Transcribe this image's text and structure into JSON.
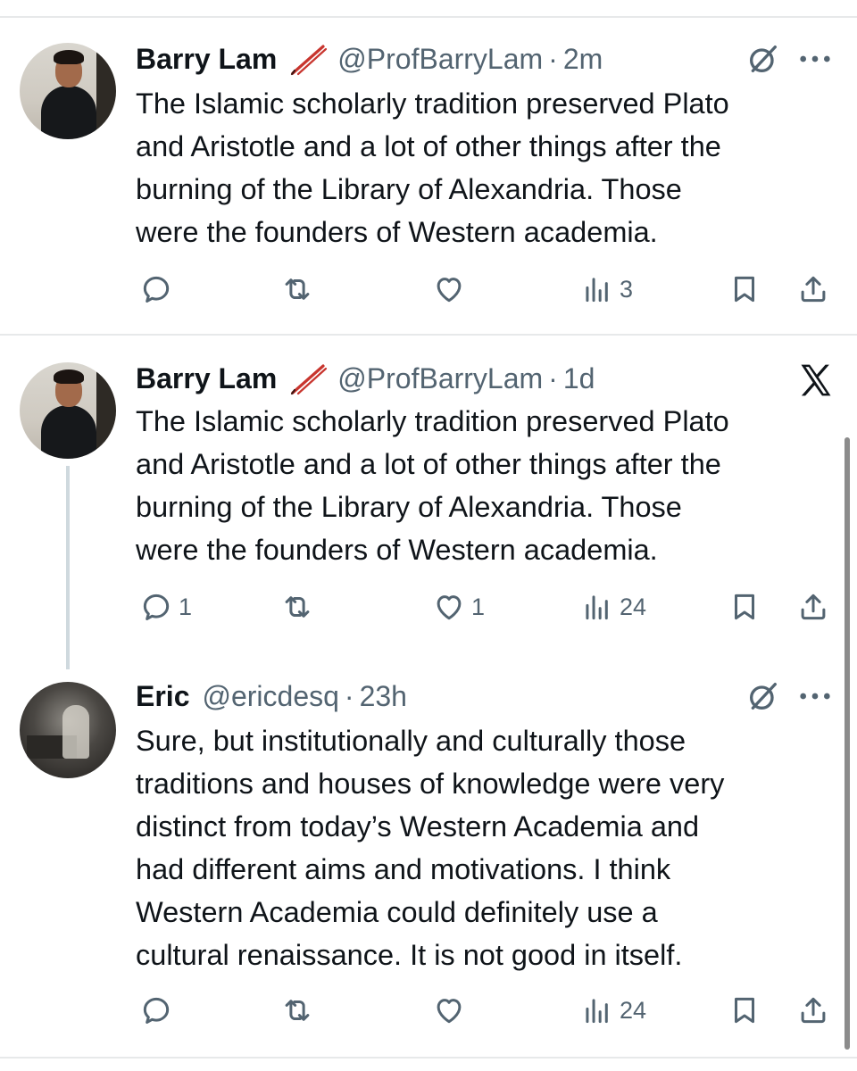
{
  "tweets": [
    {
      "name": "Barry Lam",
      "handle": "@ProfBarryLam",
      "separator": "·",
      "time": "2m",
      "lines": [
        "The Islamic scholarly tradition preserved Plato",
        "and Aristotle and a lot of other things after the",
        "burning of the Library of Alexandria. Those",
        "were the founders of Western academia."
      ],
      "replies": "",
      "retweets": "",
      "likes": "",
      "views": "3"
    },
    {
      "name": "Barry Lam",
      "handle": "@ProfBarryLam",
      "separator": "·",
      "time": "1d",
      "lines": [
        "The Islamic scholarly tradition preserved Plato",
        "and Aristotle and a lot of other things after the",
        "burning of the Library of Alexandria. Those",
        "were the founders of Western academia."
      ],
      "replies": "1",
      "retweets": "",
      "likes": "1",
      "views": "24"
    },
    {
      "name": "Eric",
      "handle": "@ericdesq",
      "separator": "·",
      "time": "23h",
      "lines": [
        "Sure, but institutionally and culturally those",
        "traditions and houses of knowledge were very",
        "distinct from today’s Western Academia and",
        "had different aims and motivations. I think",
        "Western Academia could definitely use a",
        "cultural renaissance. It is not good in itself."
      ],
      "replies": "",
      "retweets": "",
      "likes": "",
      "views": "24"
    }
  ],
  "icons": {
    "emoji": "pencil-icon",
    "grok": "grok-icon",
    "more": "more-icon",
    "x_logo": "x-logo-icon",
    "reply": "reply-icon",
    "retweet": "retweet-icon",
    "like": "like-icon",
    "views": "views-icon",
    "bookmark": "bookmark-icon",
    "share": "share-icon"
  },
  "colors": {
    "text": "#0f1419",
    "secondary": "#536471",
    "divider": "#e7e9ea"
  }
}
